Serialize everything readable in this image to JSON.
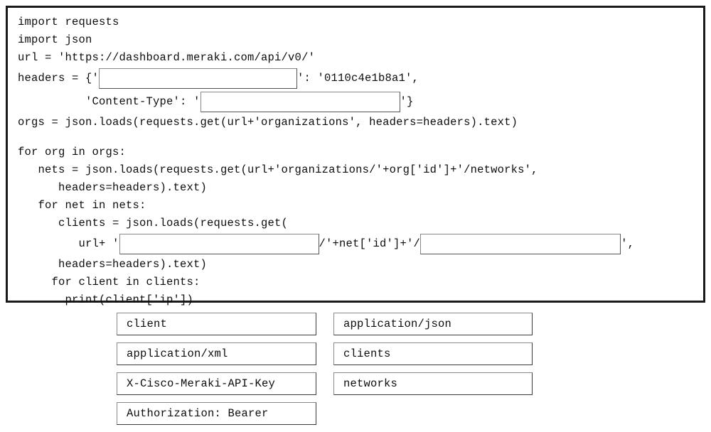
{
  "exercise": {
    "type": "drag-and-drop-code-completion",
    "code_panel": {
      "lines": [
        {
          "id": "l1",
          "text": "import requests"
        },
        {
          "id": "l2",
          "text": "import json"
        },
        {
          "id": "l3",
          "text": "url = 'https://dashboard.meraki.com/api/v0/'"
        },
        {
          "id": "l4a",
          "text": "headers = {'"
        },
        {
          "id": "l4b",
          "text": "': '0110c4e1b8a1',"
        },
        {
          "id": "l5a",
          "text": "          'Content-Type': '"
        },
        {
          "id": "l5b",
          "text": "'}"
        },
        {
          "id": "l6",
          "text": "orgs = json.loads(requests.get(url+'organizations', headers=headers).text)"
        },
        {
          "id": "l7",
          "text": ""
        },
        {
          "id": "l8",
          "text": "for org in orgs:"
        },
        {
          "id": "l9",
          "text": "   nets = json.loads(requests.get(url+'organizations/'+org['id']+'/networks',"
        },
        {
          "id": "l10",
          "text": "      headers=headers).text)"
        },
        {
          "id": "l11",
          "text": "   for net in nets:"
        },
        {
          "id": "l12",
          "text": "      clients = json.loads(requests.get("
        },
        {
          "id": "l13a",
          "text": "         url+ '"
        },
        {
          "id": "l13b",
          "text": "/'+net['id']+'/"
        },
        {
          "id": "l13c",
          "text": "',"
        },
        {
          "id": "l14",
          "text": "      headers=headers).text)"
        },
        {
          "id": "l15",
          "text": "     for client in clients:"
        },
        {
          "id": "l16",
          "text": "       print(client['ip'])"
        }
      ],
      "blanks": [
        {
          "id": "blank-1",
          "label": "header-key-blank",
          "value": ""
        },
        {
          "id": "blank-2",
          "label": "content-type-blank",
          "value": ""
        },
        {
          "id": "blank-3",
          "label": "networks-path-blank",
          "value": ""
        },
        {
          "id": "blank-4",
          "label": "clients-path-blank",
          "value": ""
        }
      ],
      "api_key": "0110c4e1b8a1",
      "base_url": "https://dashboard.meraki.com/api/v0/"
    },
    "answer_bank": {
      "left_column": [
        {
          "label": "client"
        },
        {
          "label": "application/xml"
        },
        {
          "label": "X-Cisco-Meraki-API-Key"
        },
        {
          "label": "Authorization: Bearer"
        }
      ],
      "right_column": [
        {
          "label": "application/json"
        },
        {
          "label": "clients"
        },
        {
          "label": "networks"
        }
      ]
    },
    "colors": {
      "panel_border": "#1a1a1a",
      "blank_border": "#555555",
      "option_border": "#3a3a3a",
      "background": "#ffffff",
      "text": "#0d0d0d"
    }
  }
}
